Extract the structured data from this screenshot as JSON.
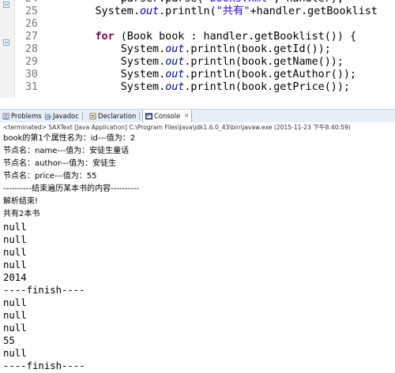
{
  "editor": {
    "lines": [
      {
        "num": "24",
        "parts": [
          {
            "t": "            parser.parse(\""
          },
          {
            "t": "books.xml",
            "c": "str"
          },
          {
            "t": "\", handler);"
          }
        ]
      },
      {
        "num": "25",
        "parts": [
          {
            "t": "        System."
          },
          {
            "t": "out",
            "c": "fld"
          },
          {
            "t": ".println("
          },
          {
            "t": "\"共有\"",
            "c": "str"
          },
          {
            "t": "+handler.getBooklist"
          }
        ]
      },
      {
        "num": "26",
        "parts": [
          {
            "t": ""
          }
        ]
      },
      {
        "num": "27",
        "parts": [
          {
            "t": "        "
          },
          {
            "t": "for",
            "c": "kw"
          },
          {
            "t": " (Book book : handler.getBooklist()) {"
          }
        ]
      },
      {
        "num": "28",
        "parts": [
          {
            "t": "            System."
          },
          {
            "t": "out",
            "c": "fld"
          },
          {
            "t": ".println(book.getId());"
          }
        ]
      },
      {
        "num": "29",
        "parts": [
          {
            "t": "            System."
          },
          {
            "t": "out",
            "c": "fld"
          },
          {
            "t": ".println(book.getName());"
          }
        ]
      },
      {
        "num": "30",
        "parts": [
          {
            "t": "            System."
          },
          {
            "t": "out",
            "c": "fld"
          },
          {
            "t": ".println(book.getAuthor());"
          }
        ]
      },
      {
        "num": "31",
        "parts": [
          {
            "t": "            System."
          },
          {
            "t": "out",
            "c": "fld"
          },
          {
            "t": ".println(book.getPrice());"
          }
        ]
      }
    ]
  },
  "tabs": [
    {
      "label": "Problems",
      "icon": "problems-icon",
      "active": false
    },
    {
      "label": "Javadoc",
      "icon": "javadoc-icon",
      "active": false
    },
    {
      "label": "Declaration",
      "icon": "declaration-icon",
      "active": false
    },
    {
      "label": "Console",
      "icon": "console-icon",
      "active": true,
      "close": "✕"
    }
  ],
  "console": {
    "status": "<terminated> SAXText [Java Application] C:\\Program Files\\Java\\jdk1.6.0_43\\bin\\javaw.exe (2015-11-23 下午8:40:59)",
    "output": [
      "book的第1个属性名为：id---值为：2",
      "节点名：name---值为：安徒生童话",
      "节点名：author---值为：安徒生",
      "节点名：price---值为：55",
      "----------结束遍历某本书的内容----------",
      "解析结束!",
      "共有2本书",
      "null",
      "null",
      "null",
      "null",
      "2014",
      "----finish----",
      "null",
      "null",
      "null",
      "55",
      "null",
      "----finish----"
    ]
  },
  "colors": {
    "keyword": "#7f0055",
    "field": "#0000c0",
    "string": "#2a00ff",
    "tabbar": "#e8eef8"
  }
}
